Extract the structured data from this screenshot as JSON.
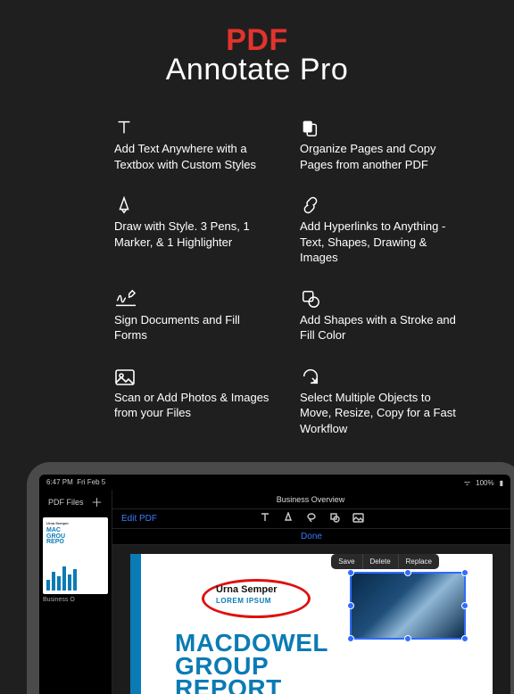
{
  "hero": {
    "title": "PDF",
    "subtitle": "Annotate Pro"
  },
  "features": [
    {
      "icon": "text-icon",
      "text": "Add Text Anywhere with a Textbox with Custom Styles"
    },
    {
      "icon": "pages-icon",
      "text": "Organize Pages and Copy Pages from another PDF"
    },
    {
      "icon": "pen-icon",
      "text": "Draw with Style. 3 Pens, 1 Marker, & 1 Highlighter"
    },
    {
      "icon": "link-icon",
      "text": "Add Hyperlinks to Anything - Text, Shapes, Drawing & Images"
    },
    {
      "icon": "signature-icon",
      "text": "Sign Documents and Fill Forms"
    },
    {
      "icon": "shapes-icon",
      "text": "Add Shapes with a Stroke and Fill Color"
    },
    {
      "icon": "photo-icon",
      "text": "Scan or Add Photos & Images from your Files"
    },
    {
      "icon": "select-icon",
      "text": "Select Multiple Objects to Move, Resize, Copy for a Fast Workflow"
    }
  ],
  "status": {
    "time": "6:47 PM",
    "date": "Fri Feb 5",
    "battery": "100%"
  },
  "sidebar": {
    "header": "PDF Files",
    "thumb_label": "Business O",
    "thumb_small": "Urna Semper",
    "thumb_title": "MAC\nGROU\nREPO"
  },
  "topbar": {
    "title": "Business Overview"
  },
  "toolbar": {
    "edit": "Edit PDF"
  },
  "donebar": {
    "label": "Done"
  },
  "popup": {
    "save": "Save",
    "delete": "Delete",
    "replace": "Replace"
  },
  "doc": {
    "ellipse_title": "Urna Semper",
    "ellipse_sub": "LOREM IPSUM",
    "big_title": "MACDOWEL\nGROUP\nREPORT"
  }
}
